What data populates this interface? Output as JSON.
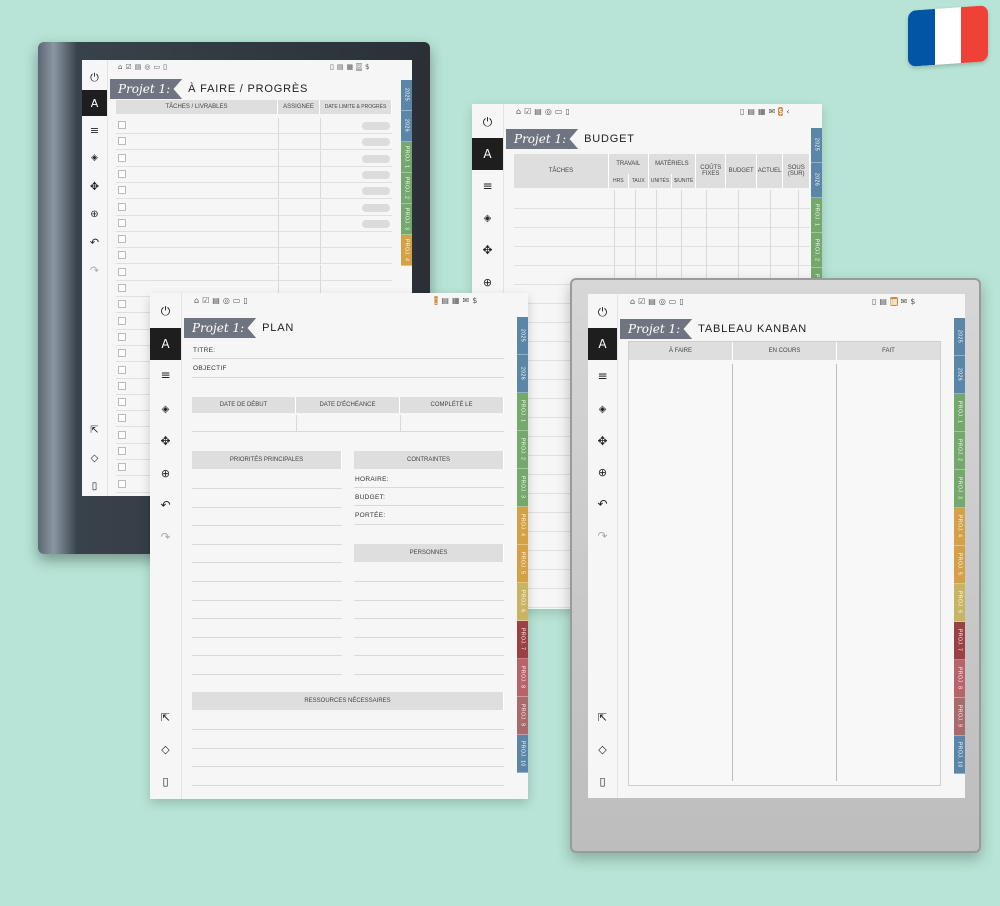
{
  "flag": {
    "colors": [
      "#0055a4",
      "#ffffff",
      "#ef4135"
    ]
  },
  "nav_icons": [
    "home-icon",
    "checkbox-icon",
    "clipboard-icon",
    "target-icon",
    "wallet-icon",
    "page-icon"
  ],
  "nav_icons_right": [
    "notebook-icon",
    "folder-icon",
    "calendar-icon",
    "mail-icon",
    "dollar-icon"
  ],
  "toolbar_icons": [
    "power-icon",
    "pen-icon",
    "lines-icon",
    "eraser-icon",
    "move-icon",
    "zoom-icon",
    "undo-icon",
    "redo-icon",
    "share-icon",
    "layers-icon",
    "notebook-icon"
  ],
  "tabs": [
    {
      "label": "2025",
      "color": "#5b86a8"
    },
    {
      "label": "2026",
      "color": "#5b86a8"
    },
    {
      "label": "PROJ. 1",
      "color": "#74a86c"
    },
    {
      "label": "PROJ. 2",
      "color": "#74a86c"
    },
    {
      "label": "PROJ. 3",
      "color": "#74a86c"
    },
    {
      "label": "PROJ. 4",
      "color": "#d4a146"
    },
    {
      "label": "PROJ. 5",
      "color": "#d4a146"
    },
    {
      "label": "PROJ. 6",
      "color": "#c9b463"
    },
    {
      "label": "PROJ. 7",
      "color": "#9c4143"
    },
    {
      "label": "PROJ. 8",
      "color": "#b8626a"
    },
    {
      "label": "PROJ. 9",
      "color": "#a86a6a"
    },
    {
      "label": "PROJ. 10",
      "color": "#5b86a8"
    }
  ],
  "ribbon": "Projet 1:",
  "todo": {
    "title": "À FAIRE / PROGRÈS",
    "col_tasks": "TÂCHES / LIVRABLES",
    "col_assignee": "ASSIGNEE",
    "col_deadline": "DATE LIMITE & PROGRÈS"
  },
  "budget": {
    "title": "BUDGET",
    "col_tasks": "TÂCHES",
    "col_travail": "TRAVAIL",
    "col_materiels": "MATÉRIELS",
    "col_couts": "COÛTS FIXES",
    "col_budget": "BUDGET",
    "col_actuel": "ACTUEL",
    "col_sous": "SOUS (SUR)",
    "sub_hrs": "HRS",
    "sub_taux": "TAUX",
    "sub_unites": "UNITÉS",
    "sub_unite": "$/UNITÉ"
  },
  "plan": {
    "title": "PLAN",
    "titre": "TITRE:",
    "objectif": "OBJECTIF",
    "date_debut": "DATE DE DÉBUT",
    "date_echeance": "DATE D'ÉCHÉANCE",
    "complete": "COMPLÉTÉ LE",
    "priorites": "PRIORITÉS PRINCIPALES",
    "contraintes": "CONTRAINTES",
    "horaire": "HORAIRE:",
    "budget": "BUDGET:",
    "portee": "PORTÉE:",
    "personnes": "PERSONNES",
    "ressources": "RESSOURCES NÉCESSAIRES"
  },
  "kanban": {
    "title": "TABLEAU KANBAN",
    "col_todo": "À FAIRE",
    "col_doing": "EN COURS",
    "col_done": "FAIT"
  }
}
